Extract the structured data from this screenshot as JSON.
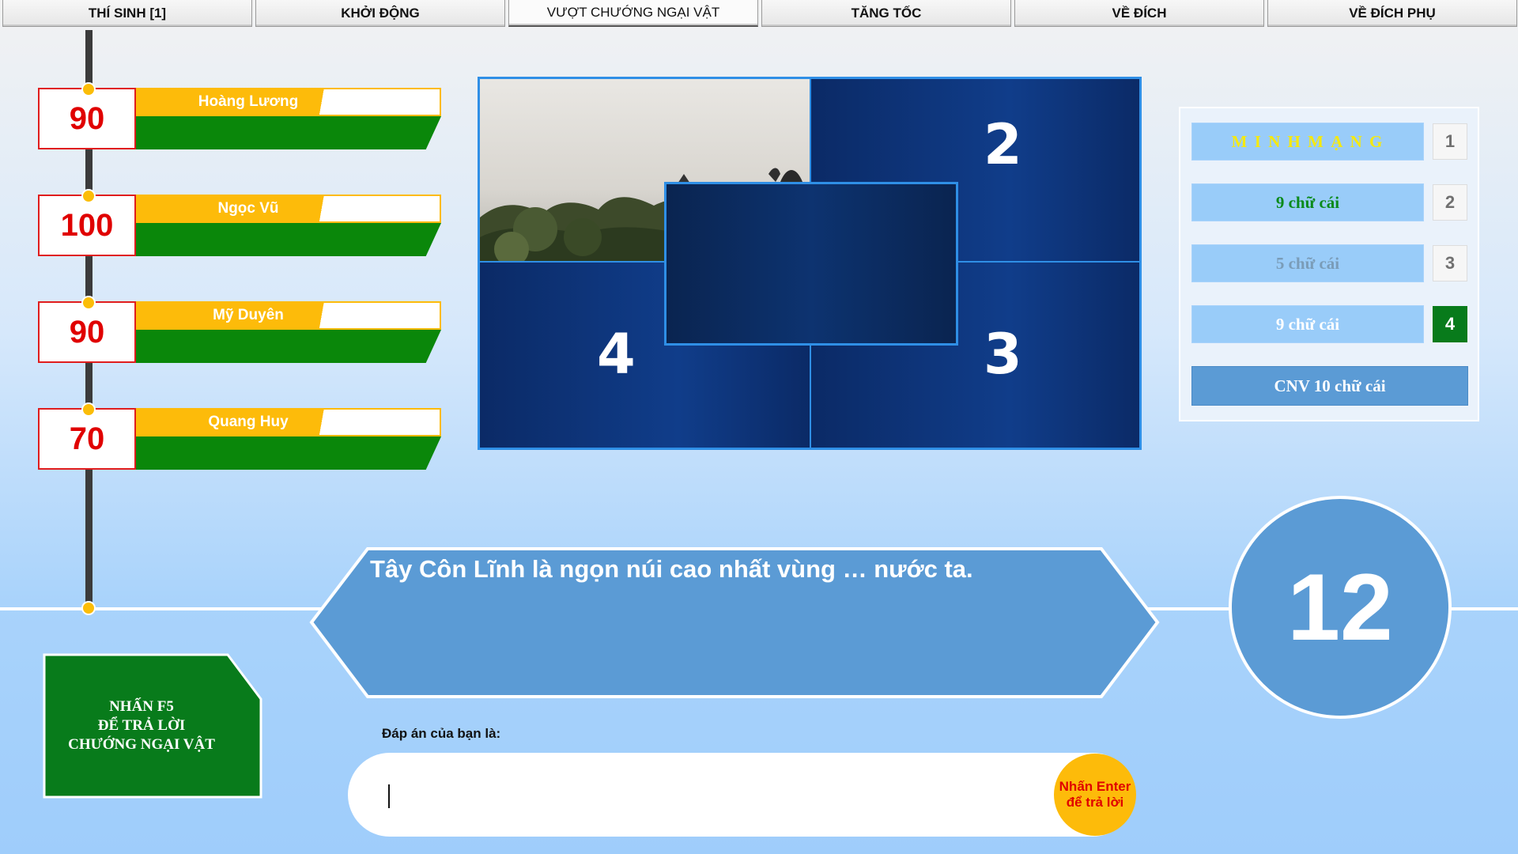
{
  "tabs": [
    {
      "label": "THÍ SINH [1]"
    },
    {
      "label": "KHỞI ĐỘNG"
    },
    {
      "label": "VƯỢT CHƯỚNG NGẠI VẬT"
    },
    {
      "label": "TĂNG TỐC"
    },
    {
      "label": "VỀ ĐÍCH"
    },
    {
      "label": "VỀ ĐÍCH PHỤ"
    }
  ],
  "active_tab": "VƯỢT CHƯỚNG NGẠI VẬT",
  "players": [
    {
      "name": "Hoàng Lương",
      "score": "90"
    },
    {
      "name": "Ngọc Vũ",
      "score": "100"
    },
    {
      "name": "Mỹ Duyên",
      "score": "90"
    },
    {
      "name": "Quang Huy",
      "score": "70"
    }
  ],
  "puzzle": {
    "pieces": [
      {
        "number": "2"
      },
      {
        "number": "4"
      },
      {
        "number": "3"
      }
    ]
  },
  "keywords": [
    {
      "text": "M I N H M Ạ N G",
      "number": "1",
      "color": "#f5e90f"
    },
    {
      "text": "9 chữ cái",
      "number": "2",
      "color": "#0a8a1a"
    },
    {
      "text": "5 chữ cái",
      "number": "3",
      "color": "#7a9cb8"
    },
    {
      "text": "9 chữ cái",
      "number": "4",
      "color": "#ffffff"
    }
  ],
  "cnv_label": "CNV 10 chữ cái",
  "question": "Tây Côn Lĩnh là ngọn núi cao nhất vùng … nước ta.",
  "timer": "12",
  "f5_hint": "NHẤN F5\nĐỂ TRẢ LỜI\nCHƯỚNG NGẠI VẬT",
  "answer_label": "Đáp án của bạn là:",
  "answer_value": "",
  "enter_hint": "Nhấn Enter\nđể trả lời",
  "colors": {
    "score_border": "#e01d1d",
    "name_bar": "#fdbb0a",
    "green_bar": "#0a870a",
    "accent_blue": "#5b9bd5",
    "active_number": "#087b1b"
  }
}
